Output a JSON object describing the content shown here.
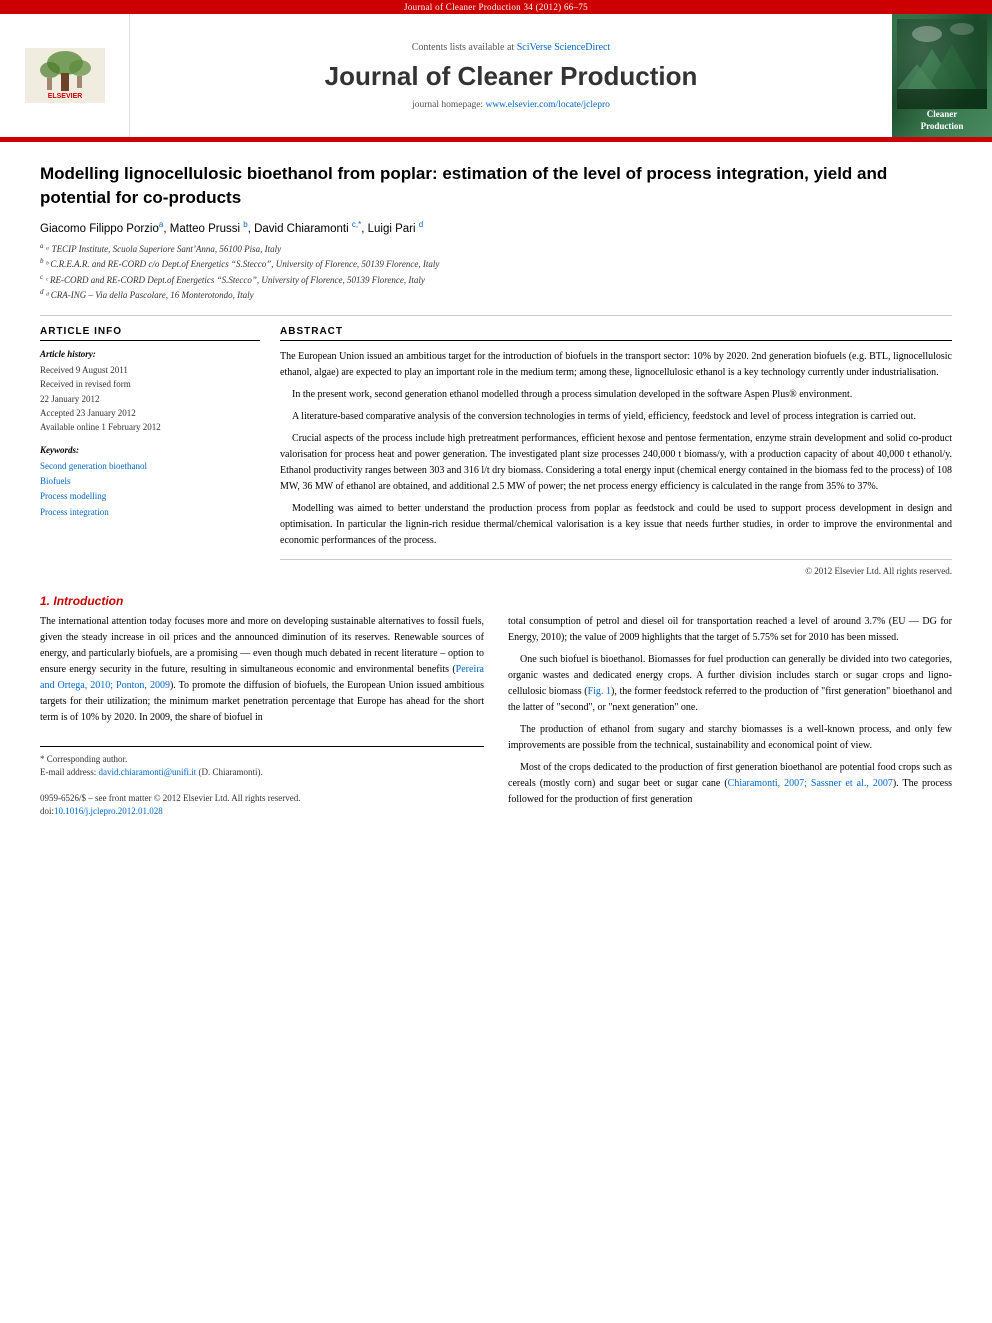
{
  "topBar": {
    "text": "Journal of Cleaner Production 34 (2012) 66–75"
  },
  "header": {
    "sciverse": "Contents lists available at",
    "sciverse_link": "SciVerse ScienceDirect",
    "journal_title": "Journal of Cleaner Production",
    "homepage_label": "journal homepage:",
    "homepage_url": "www.elsevier.com/locate/jclepro",
    "elsevier_label": "ELSEVIER",
    "cleaner_prod_label": "Cleaner\nProduction"
  },
  "paper": {
    "title": "Modelling lignocellulosic bioethanol from poplar: estimation of the level of process integration, yield and potential for co-products",
    "authors": "Giacomo Filippo Porzioᵃ, Matteo Prussi ᵇ, David Chiaramonti ᶜ,*, Luigi Pari ᵈ",
    "affiliations": [
      "ᵃ TECIP Institute, Scuola Superiore Sant’Anna, 56100 Pisa, Italy",
      "ᵇ C.R.E.A.R. and RE-CORD c/o Dept.of Energetics “S.Stecco”, University of Florence, 50139 Florence, Italy",
      "ᶜ RE-CORD and RE-CORD Dept.of Energetics “S.Stecco”, University of Florence, 50139 Florence, Italy",
      "ᵈ CRA-ING – Via della Pascolare, 16 Monterotondo, Italy"
    ]
  },
  "articleInfo": {
    "label": "Article Info",
    "history_title": "Article history:",
    "received": "Received 9 August 2011",
    "revised": "Received in revised form\n22 January 2012",
    "accepted": "Accepted 23 January 2012",
    "available": "Available online 1 February 2012",
    "keywords_title": "Keywords:",
    "keywords": [
      "Second generation bioethanol",
      "Biofuels",
      "Process modelling",
      "Process integration"
    ]
  },
  "abstract": {
    "label": "Abstract",
    "paragraphs": [
      "The European Union issued an ambitious target for the introduction of biofuels in the transport sector: 10% by 2020. 2nd generation biofuels (e.g. BTL, lignocellulosic ethanol, algae) are expected to play an important role in the medium term; among these, lignocellulosic ethanol is a key technology currently under industrialisation.",
      "In the present work, second generation ethanol modelled through a process simulation developed in the software Aspen Plus® environment.",
      "A literature-based comparative analysis of the conversion technologies in terms of yield, efficiency, feedstock and level of process integration is carried out.",
      "Crucial aspects of the process include high pretreatment performances, efficient hexose and pentose fermentation, enzyme strain development and solid co-product valorisation for process heat and power generation. The investigated plant size processes 240,000 t biomass/y, with a production capacity of about 40,000 t ethanol/y. Ethanol productivity ranges between 303 and 316 l/t dry biomass. Considering a total energy input (chemical energy contained in the biomass fed to the process) of 108 MW, 36 MW of ethanol are obtained, and additional 2.5 MW of power; the net process energy efficiency is calculated in the range from 35% to 37%.",
      "Modelling was aimed to better understand the production process from poplar as feedstock and could be used to support process development in design and optimisation. In particular the lignin-rich residue thermal/chemical valorisation is a key issue that needs further studies, in order to improve the environmental and economic performances of the process."
    ],
    "copyright": "© 2012 Elsevier Ltd. All rights reserved."
  },
  "introduction": {
    "section_number": "1.",
    "section_title": "Introduction",
    "left_paragraphs": [
      "The international attention today focuses more and more on developing sustainable alternatives to fossil fuels, given the steady increase in oil prices and the announced diminution of its reserves. Renewable sources of energy, and particularly biofuels, are a promising — even though much debated in recent literature – option to ensure energy security in the future, resulting in simultaneous economic and environmental benefits (Pereira and Ortega, 2010; Ponton, 2009). To promote the diffusion of biofuels, the European Union issued ambitious targets for their utilization; the minimum market penetration percentage that Europe has ahead for the short term is of 10% by 2020. In 2009, the share of biofuel in"
    ],
    "right_paragraphs": [
      "total consumption of petrol and diesel oil for transportation reached a level of around 3.7% (EU — DG for Energy, 2010); the value of 2009 highlights that the target of 5.75% set for 2010 has been missed.",
      "One such biofuel is bioethanol. Biomasses for fuel production can generally be divided into two categories, organic wastes and dedicated energy crops. A further division includes starch or sugar crops and ligno-cellulosic biomass (Fig. 1), the former feedstock referred to the production of “first generation” bioethanol and the latter of “second”, or “next generation” one.",
      "The production of ethanol from sugary and starchy biomasses is a well-known process, and only few improvements are possible from the technical, sustainability and economical point of view.",
      "Most of the crops dedicated to the production of first generation bioethanol are potential food crops such as cereals (mostly corn) and sugar beet or sugar cane (Chiaramonti, 2007; Sassner et al., 2007). The process followed for the production of first generation"
    ]
  },
  "footnotes": {
    "corresponding": "* Corresponding author.",
    "email_label": "E-mail address:",
    "email": "david.chiaramonti@unifi.it",
    "email_note": "(D. Chiaramonti)."
  },
  "bottomInfo": {
    "issn": "0959-6526/$ – see front matter © 2012 Elsevier Ltd. All rights reserved.",
    "doi": "doi:10.1016/j.jclepro.2012.01.028"
  }
}
